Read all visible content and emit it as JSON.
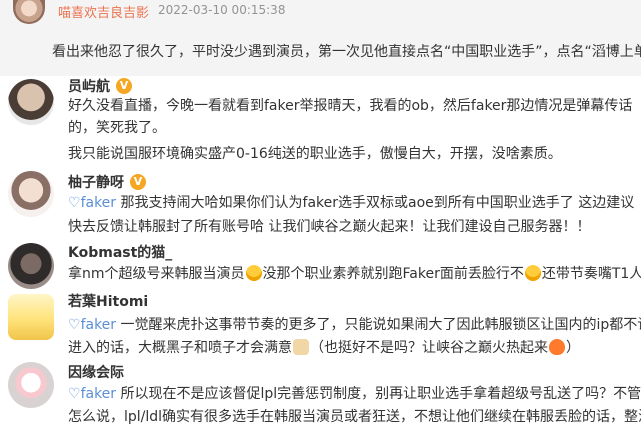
{
  "top": {
    "user": "喵喜欢吉良吉影",
    "time": "2022-03-10 00:15:38",
    "text": "看出来他忍了很久了，平时没少遇到演员，第一次见他直接点名“中国职业选手”，点名“滔博上单”"
  },
  "comments": [
    {
      "user": "员屿航",
      "verified": true,
      "lines": [
        "好久没看直播，今晚一看就看到faker举报晴天，我看的ob，然后faker那边情况是弹幕传话",
        "的，笑死我了。",
        "我只能说国服环境确实盛产0-16纯送的职业选手，傲慢自大，开摆，没啥素质。"
      ]
    },
    {
      "user": "柚子静呀",
      "verified": true,
      "tag": "faker",
      "lines": [
        "那我支持闹大哈如果你们认为faker选手双标或aoe到所有中国职业选手了 这边建议",
        "快去反馈让韩服封了所有账号哈 让我们峡谷之巅火起来！让我们建设自己服务器！！"
      ]
    },
    {
      "user": "Kobmast的猫_",
      "verified": false,
      "lines": {
        "a": "拿nm个超级号来韩服当演员",
        "b": "没那个职业素养就别跑Faker面前丢脸行不",
        "c": "还带节奏嘴T1人"
      }
    },
    {
      "user": "若葉Hitomi",
      "verified": false,
      "tag": "faker",
      "lines": {
        "l1": "一觉醒来虎扑这事带节奏的更多了，只能说如果闹大了因此韩服锁区让国内的ip都不许",
        "l2a": "进入的话，大概黑子和喷子才会满意",
        "l2b": "（也挺好不是吗？让峡谷之巅火热起来",
        "l2c": "）"
      }
    },
    {
      "user": "因缘会际",
      "verified": false,
      "tag": "faker",
      "lines": [
        "所以现在不是应该督促lpl完善惩罚制度，别再让职业选手拿着超级号乱送了吗？不管",
        "怎么说，lpl/ldl确实有很多选手在韩服当演员或者狂送，不想让他们继续在韩服丢脸的话，整治一"
      ]
    }
  ],
  "colors": {
    "username_top": "#eb7350",
    "mention": "#5a8fd8",
    "badge": "#f5a623"
  }
}
